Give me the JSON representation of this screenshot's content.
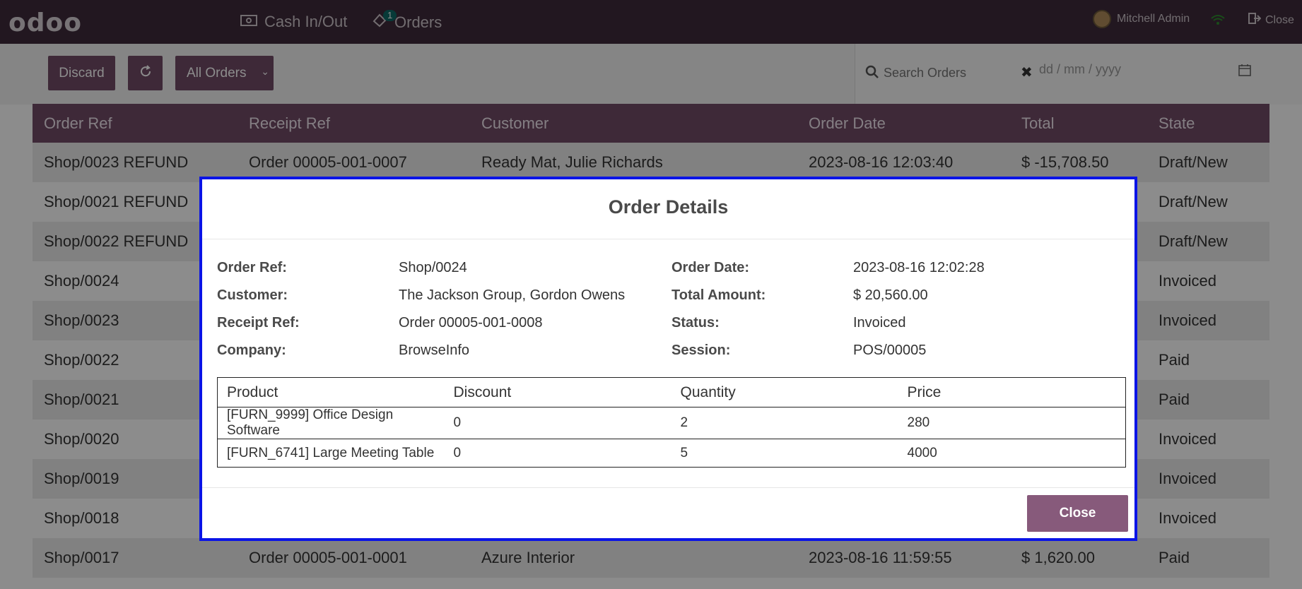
{
  "navbar": {
    "logo": "odoo",
    "cash_label": "Cash In/Out",
    "orders_label": "Orders",
    "orders_badge": "1",
    "user_name": "Mitchell Admin",
    "close_label": "Close"
  },
  "controls": {
    "discard_label": "Discard",
    "filter_label": "All Orders",
    "search_placeholder": "Search Orders",
    "date_placeholder": "dd / mm / yyyy"
  },
  "orders_table": {
    "headers": [
      "Order Ref",
      "Receipt Ref",
      "Customer",
      "Order Date",
      "Total",
      "State"
    ],
    "rows": [
      [
        "Shop/0023 REFUND",
        "Order 00005-001-0007",
        "Ready Mat, Julie Richards",
        "2023-08-16 12:03:40",
        "$ -15,708.50",
        "Draft/New"
      ],
      [
        "Shop/0021 REFUND",
        "",
        "",
        "",
        "",
        "Draft/New"
      ],
      [
        "Shop/0022 REFUND",
        "",
        "",
        "",
        "",
        "Draft/New"
      ],
      [
        "Shop/0024",
        "",
        "",
        "",
        "",
        "Invoiced"
      ],
      [
        "Shop/0023",
        "",
        "",
        "",
        "",
        "Invoiced"
      ],
      [
        "Shop/0022",
        "",
        "",
        "",
        "",
        "Paid"
      ],
      [
        "Shop/0021",
        "",
        "",
        "",
        "",
        "Paid"
      ],
      [
        "Shop/0020",
        "",
        "",
        "",
        "",
        "Invoiced"
      ],
      [
        "Shop/0019",
        "",
        "",
        "",
        "",
        "Invoiced"
      ],
      [
        "Shop/0018",
        "",
        "",
        "",
        "",
        "Invoiced"
      ],
      [
        "Shop/0017",
        "Order 00005-001-0001",
        "Azure Interior",
        "2023-08-16 11:59:55",
        "$ 1,620.00",
        "Paid"
      ]
    ]
  },
  "modal": {
    "title": "Order Details",
    "order_ref_label": "Order Ref:",
    "order_ref": "Shop/0024",
    "customer_label": "Customer:",
    "customer": "The Jackson Group, Gordon Owens",
    "receipt_ref_label": "Receipt Ref:",
    "receipt_ref": "Order 00005-001-0008",
    "company_label": "Company:",
    "company": "BrowseInfo",
    "order_date_label": "Order Date:",
    "order_date": "2023-08-16 12:02:28",
    "total_label": "Total Amount:",
    "total": "$ 20,560.00",
    "status_label": "Status:",
    "status": "Invoiced",
    "session_label": "Session:",
    "session": "POS/00005",
    "lines_headers": [
      "Product",
      "Discount",
      "Quantity",
      "Price"
    ],
    "lines": [
      [
        "[FURN_9999] Office Design Software",
        "0",
        "2",
        "280"
      ],
      [
        "[FURN_6741] Large Meeting Table",
        "0",
        "5",
        "4000"
      ]
    ],
    "close_label": "Close"
  },
  "colors": {
    "brand": "#714b67",
    "navbar": "#3e2a3b",
    "modal_border": "#0a14e6",
    "close_button": "#875a7b"
  }
}
